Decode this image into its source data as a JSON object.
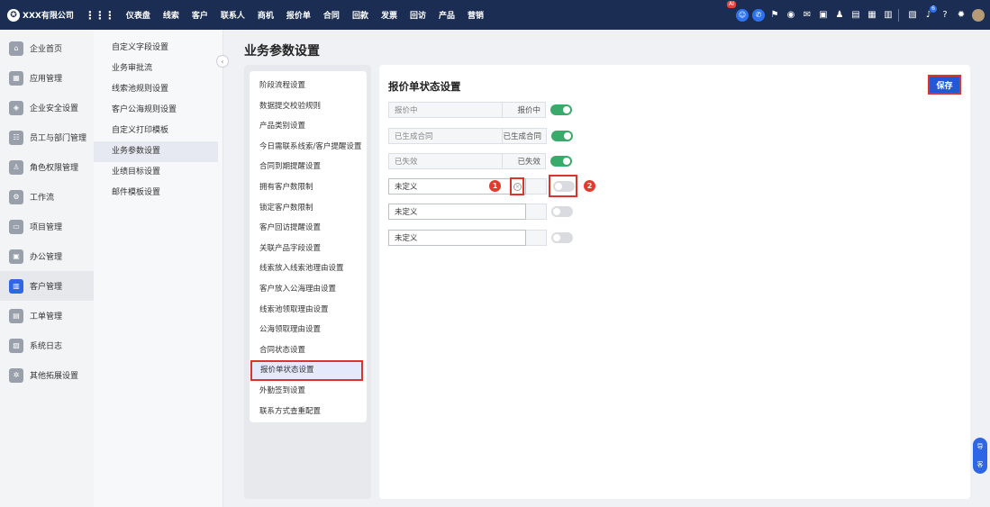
{
  "topbar": {
    "company": "XXX有限公司",
    "nav": [
      "仪表盘",
      "线索",
      "客户",
      "联系人",
      "商机",
      "报价单",
      "合同",
      "回款",
      "发票",
      "回访",
      "产品",
      "营销"
    ],
    "ai_badge": "AI",
    "notification_count": "6",
    "icons": [
      "robot-icon",
      "chat-icon",
      "flag-icon",
      "globe-icon",
      "mail-icon",
      "calendar-check-icon",
      "contact-icon",
      "document-icon",
      "calendar-icon",
      "calendar-grid-icon",
      "report-icon",
      "bell-icon",
      "help-icon",
      "gear-icon",
      "avatar"
    ]
  },
  "sidebar": {
    "items": [
      {
        "label": "企业首页",
        "icon": "home-icon"
      },
      {
        "label": "应用管理",
        "icon": "apps-icon"
      },
      {
        "label": "企业安全设置",
        "icon": "shield-icon"
      },
      {
        "label": "员工与部门管理",
        "icon": "users-icon"
      },
      {
        "label": "角色权限管理",
        "icon": "role-icon"
      },
      {
        "label": "工作流",
        "icon": "workflow-icon"
      },
      {
        "label": "项目管理",
        "icon": "project-icon"
      },
      {
        "label": "办公管理",
        "icon": "office-icon"
      },
      {
        "label": "客户管理",
        "icon": "customer-icon"
      },
      {
        "label": "工单管理",
        "icon": "ticket-icon"
      },
      {
        "label": "系统日志",
        "icon": "log-icon"
      },
      {
        "label": "其他拓展设置",
        "icon": "extension-icon"
      }
    ],
    "active_index": 8
  },
  "submenu": {
    "items": [
      "自定义字段设置",
      "业务审批流",
      "线索池规则设置",
      "客户公海规则设置",
      "自定义打印模板",
      "业务参数设置",
      "业绩目标设置",
      "邮件模板设置"
    ],
    "active_index": 5
  },
  "main": {
    "page_title": "业务参数设置",
    "param_list": [
      "阶段流程设置",
      "数据提交校验规则",
      "产品类别设置",
      "今日需联系线索/客户提醒设置",
      "合同到期提醒设置",
      "拥有客户数限制",
      "锁定客户数限制",
      "客户回访提醒设置",
      "关联产品字段设置",
      "线索放入线索池理由设置",
      "客户放入公海理由设置",
      "线索池领取理由设置",
      "公海领取理由设置",
      "合同状态设置",
      "报价单状态设置",
      "外勤签到设置",
      "联系方式查重配置"
    ],
    "param_active_index": 14,
    "content_title": "报价单状态设置",
    "save_label": "保存",
    "status_rows": [
      {
        "value": "报价中",
        "label": "报价中",
        "enabled": true
      },
      {
        "value": "已生成合同",
        "label": "已生成合同",
        "enabled": true
      },
      {
        "value": "已失效",
        "label": "已失效",
        "enabled": true
      },
      {
        "value": "未定义",
        "label": "",
        "enabled": false
      },
      {
        "value": "未定义",
        "label": "",
        "enabled": false
      },
      {
        "value": "未定义",
        "label": "",
        "enabled": false
      }
    ],
    "annotations": [
      "1",
      "2"
    ]
  },
  "float_bar": {
    "items": [
      "导",
      "客"
    ]
  },
  "colors": {
    "topbar": "#1b2d52",
    "primary": "#2257d6",
    "toggle_on": "#3aaa6a",
    "annotation": "#d9352c"
  }
}
